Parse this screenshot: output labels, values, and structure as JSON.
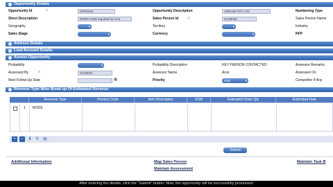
{
  "sections": {
    "opportunity_details": "Opportunity Details",
    "address_details": "Address Details",
    "lead_account_details": "Lead Account Details",
    "assess_opportunity": "Assess Opportunity",
    "revenue_breakup": "Revenue Type Wise Break up Of Estimated Revenue"
  },
  "opportunity": {
    "opportunity_id_label": "Opportunity Id",
    "opportunity_id_value": "OPP0024",
    "opportunity_desc_label": "Opportunity Description",
    "opportunity_desc_value": "ARROW PVT LTD",
    "numbering_type_label": "Numbering Type",
    "short_desc_label": "Short Description",
    "short_desc_value": "RODS CRM required for Cus",
    "sales_person_id_label": "Sales Person Id",
    "sales_person_id_value": "SC00030",
    "sales_person_name_label": "Sales Person Name",
    "geography_label": "Geography",
    "geography_value": "",
    "territory_label": "Territory",
    "territory_value": "",
    "industry_label": "Industry",
    "sales_stage_label": "Sales Stage",
    "sales_stage_value": "",
    "currency_label": "Currency",
    "currency_value": "",
    "rfp_label": "RFP"
  },
  "assess": {
    "probability_label": "Probability",
    "probability_value": "",
    "probability_desc_label": "Probability Description",
    "probability_desc_value": "KEY PERSON CONTACTED",
    "assessor_remarks_label": "Assessor Remarks",
    "assessed_by_label": "Assessed By",
    "assessed_by_value": "SC00031",
    "assessor_name_label": "Assessor Name",
    "assessor_name_value": "Arun",
    "assessed_on_label": "Assessed On",
    "next_followup_label": "Next Follow-Up Date",
    "priority_label": "Priority",
    "priority_value": "High",
    "competitor_label": "Competitor If Any"
  },
  "grid": {
    "columns": [
      "Revenue Type",
      "Product Code",
      "Item Description",
      "UOM",
      "Estimated Order Qty",
      "Estimated Rate"
    ],
    "rows": [
      {
        "num": "1",
        "revenue_type": "RODS"
      }
    ]
  },
  "submit_label": "Submit",
  "links": {
    "additional_info": "Additional Information",
    "map_sales_person": "Map Sales Person",
    "maintain_assessment": "Maintain Assessment",
    "maintain_task": "Maintain Task B"
  },
  "caption": "After entering the details, click the \"Submit\" button. Now, the opportunity will be successfully processed."
}
